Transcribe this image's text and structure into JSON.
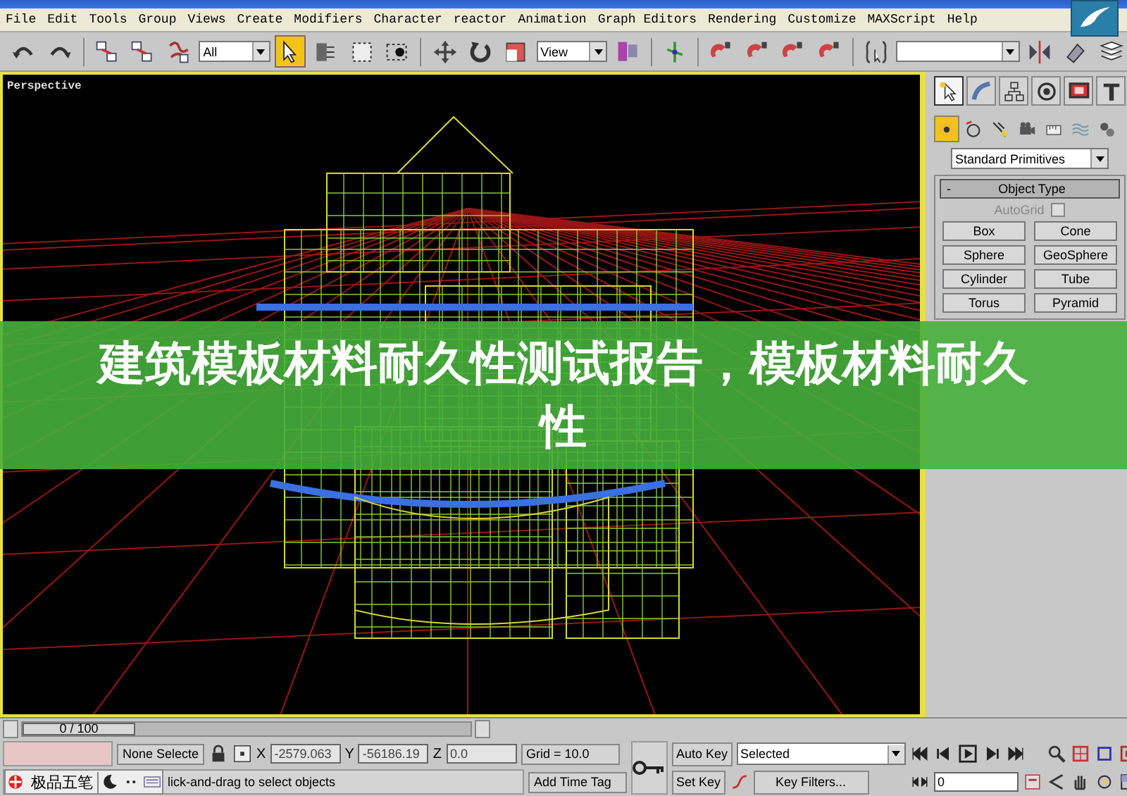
{
  "menu": [
    "File",
    "Edit",
    "Tools",
    "Group",
    "Views",
    "Create",
    "Modifiers",
    "Character",
    "reactor",
    "Animation",
    "Graph Editors",
    "Rendering",
    "Customize",
    "MAXScript",
    "Help"
  ],
  "toolbar": [
    {
      "kind": "undo",
      "selected": false
    },
    {
      "kind": "redo",
      "selected": false
    },
    {
      "kind": "sep"
    },
    {
      "kind": "link",
      "selected": false
    },
    {
      "kind": "unlink",
      "selected": false
    },
    {
      "kind": "bind",
      "selected": false
    },
    {
      "kind": "dropdown",
      "value": "All"
    },
    {
      "kind": "select",
      "selected": true
    },
    {
      "kind": "select-by-name",
      "selected": false
    },
    {
      "kind": "region",
      "selected": false
    },
    {
      "kind": "crossing",
      "selected": false
    },
    {
      "kind": "sep"
    },
    {
      "kind": "move",
      "selected": false
    },
    {
      "kind": "rotate",
      "selected": false
    },
    {
      "kind": "scale",
      "selected": false
    },
    {
      "kind": "dropdown",
      "value": "View"
    },
    {
      "kind": "pivot",
      "selected": false
    },
    {
      "kind": "sep"
    },
    {
      "kind": "manipulate",
      "selected": false
    },
    {
      "kind": "sep"
    },
    {
      "kind": "snap",
      "selected": false
    },
    {
      "kind": "angle-snap",
      "selected": false
    },
    {
      "kind": "percent-snap",
      "selected": false
    },
    {
      "kind": "spinner-snap",
      "selected": false
    },
    {
      "kind": "sep"
    },
    {
      "kind": "named-selection",
      "selected": false
    },
    {
      "kind": "dropdown-wide"
    },
    {
      "kind": "mirror",
      "selected": false
    },
    {
      "kind": "align",
      "selected": false
    },
    {
      "kind": "layers",
      "selected": false
    }
  ],
  "viewport": {
    "label": "Perspective",
    "active": true
  },
  "command_panel": {
    "tabs": [
      {
        "kind": "create",
        "selected": true
      },
      {
        "kind": "modify",
        "selected": false
      },
      {
        "kind": "hierarchy",
        "selected": false
      },
      {
        "kind": "motion",
        "selected": false
      },
      {
        "kind": "display",
        "selected": false
      },
      {
        "kind": "utilities",
        "selected": false
      }
    ],
    "subtabs": [
      {
        "kind": "geometry",
        "selected": true
      },
      {
        "kind": "shapes",
        "selected": false
      },
      {
        "kind": "lights",
        "selected": false
      },
      {
        "kind": "cameras",
        "selected": false
      },
      {
        "kind": "helpers",
        "selected": false
      },
      {
        "kind": "spacewarps",
        "selected": false
      },
      {
        "kind": "systems",
        "selected": false
      }
    ],
    "category": "Standard Primitives",
    "rollout": {
      "toggle": "-",
      "title": "Object Type",
      "autogrid": {
        "label": "AutoGrid",
        "checked": false,
        "disabled": true
      },
      "buttons": [
        "Box",
        "Cone",
        "Sphere",
        "GeoSphere",
        "Cylinder",
        "Tube",
        "Torus",
        "Pyramid"
      ]
    }
  },
  "timeline": {
    "label": "0 / 100",
    "level": 0
  },
  "status": {
    "selection": "None Selecte",
    "coords": [
      {
        "label": "X",
        "value": "-2579.063"
      },
      {
        "label": "Y",
        "value": "-56186.19"
      },
      {
        "label": "Z",
        "value": "0.0"
      }
    ],
    "grid": "Grid = 10.0",
    "time_tag": "Add Time Tag",
    "prompt": "lick-and-drag to select objects"
  },
  "ime_bar": {
    "label": "极品五笔"
  },
  "animation": {
    "auto_key": "Auto Key",
    "key_mode": "Selected",
    "set_key": "Set Key",
    "key_filters": "Key Filters...",
    "frame": "0"
  },
  "banner": {
    "text": "建筑模板材料耐久性测试报告，模板材料耐久性"
  }
}
